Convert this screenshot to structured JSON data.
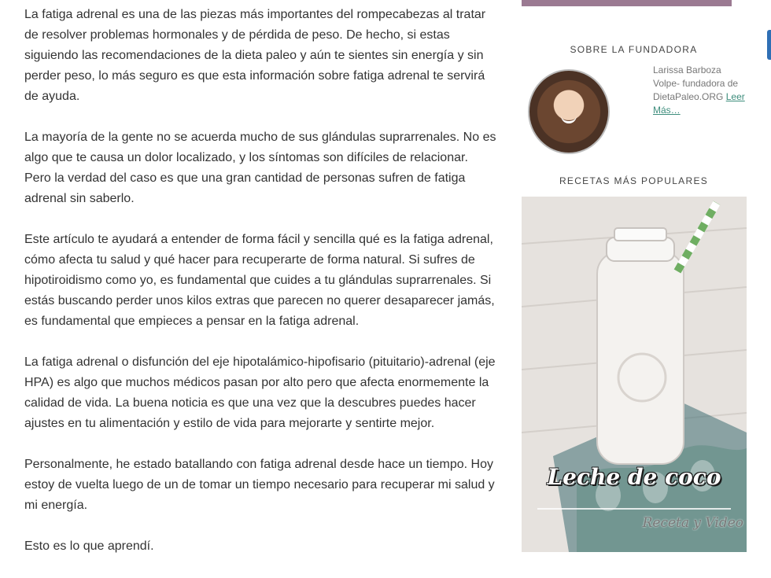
{
  "article": {
    "paragraphs": [
      "La fatiga adrenal es una de las piezas más importantes del rompecabezas al tratar de resolver problemas hormonales y de pérdida de peso. De hecho, si estas siguiendo las recomendaciones de la dieta paleo y aún te sientes sin energía y sin perder peso, lo más seguro es que esta información sobre fatiga adrenal te servirá de ayuda.",
      "La mayoría de la gente no se acuerda mucho de sus glándulas suprarrenales. No es algo que te causa un dolor localizado, y los síntomas son difíciles de relacionar. Pero la verdad del caso es que una gran cantidad de personas sufren de fatiga adrenal sin saberlo.",
      "Este artículo te ayudará a entender de forma fácil y sencilla qué es la fatiga adrenal, cómo afecta tu salud y qué hacer para recuperarte de forma natural. Si sufres de hipotiroidismo como yo, es fundamental que cuides a tu glándulas suprarrenales. Si estás buscando perder unos kilos extras que parecen no querer desaparecer jamás, es fundamental que empieces a pensar en la fatiga adrenal.",
      "La fatiga adrenal o disfunción del eje hipotalámico-hipofisario (pituitario)-adrenal (eje HPA) es algo que muchos médicos pasan por alto pero que afecta enormemente la calidad de vida. La buena noticia es que una vez que la descubres puedes hacer ajustes en tu alimentación y estilo de vida para mejorarte y sentirte mejor.",
      "Personalmente, he estado batallando con fatiga adrenal desde hace un tiempo. Hoy estoy de vuelta luego de un de tomar un tiempo necesario para recuperar mi salud y mi energía.",
      "Esto es lo que aprendí."
    ]
  },
  "sidebar": {
    "founder": {
      "title": "SOBRE LA FUNDADORA",
      "text": "Larissa Barboza Volpe- fundadora de DietaPaleo.ORG",
      "link": "Leer Más…"
    },
    "popular": {
      "title": "RECETAS MÁS POPULARES",
      "recipe_title": "Leche de coco",
      "recipe_subtitle": "Receta y Video"
    }
  },
  "colors": {
    "accent_bar": "#9b7a92",
    "link": "#3d8d7c"
  }
}
